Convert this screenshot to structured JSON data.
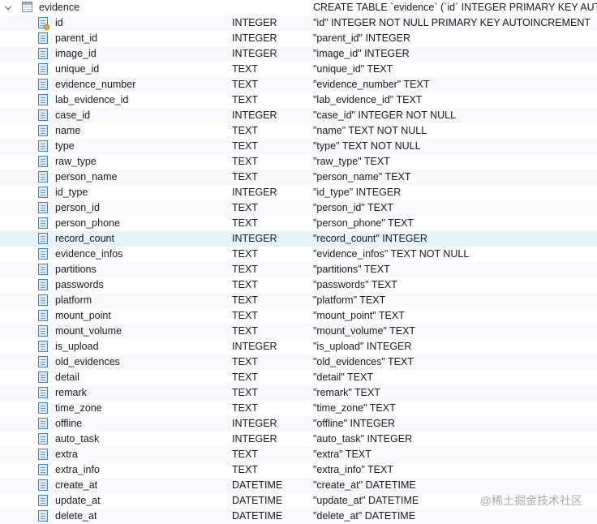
{
  "table": {
    "name": "evidence",
    "schema": "CREATE TABLE `evidence` (`id` INTEGER PRIMARY KEY AUTOINCREMENT"
  },
  "hover_field": "record_count",
  "fields": [
    {
      "name": "id",
      "type": "INTEGER",
      "schema": "\"id\" INTEGER NOT NULL PRIMARY KEY AUTOINCREMENT",
      "key": true
    },
    {
      "name": "parent_id",
      "type": "INTEGER",
      "schema": "\"parent_id\" INTEGER"
    },
    {
      "name": "image_id",
      "type": "INTEGER",
      "schema": "\"image_id\" INTEGER"
    },
    {
      "name": "unique_id",
      "type": "TEXT",
      "schema": "\"unique_id\" TEXT"
    },
    {
      "name": "evidence_number",
      "type": "TEXT",
      "schema": "\"evidence_number\" TEXT"
    },
    {
      "name": "lab_evidence_id",
      "type": "TEXT",
      "schema": "\"lab_evidence_id\" TEXT"
    },
    {
      "name": "case_id",
      "type": "INTEGER",
      "schema": "\"case_id\" INTEGER NOT NULL"
    },
    {
      "name": "name",
      "type": "TEXT",
      "schema": "\"name\" TEXT NOT NULL"
    },
    {
      "name": "type",
      "type": "TEXT",
      "schema": "\"type\" TEXT NOT NULL"
    },
    {
      "name": "raw_type",
      "type": "TEXT",
      "schema": "\"raw_type\" TEXT"
    },
    {
      "name": "person_name",
      "type": "TEXT",
      "schema": "\"person_name\" TEXT"
    },
    {
      "name": "id_type",
      "type": "INTEGER",
      "schema": "\"id_type\" INTEGER"
    },
    {
      "name": "person_id",
      "type": "TEXT",
      "schema": "\"person_id\" TEXT"
    },
    {
      "name": "person_phone",
      "type": "TEXT",
      "schema": "\"person_phone\" TEXT"
    },
    {
      "name": "record_count",
      "type": "INTEGER",
      "schema": "\"record_count\" INTEGER"
    },
    {
      "name": "evidence_infos",
      "type": "TEXT",
      "schema": "\"evidence_infos\" TEXT NOT NULL"
    },
    {
      "name": "partitions",
      "type": "TEXT",
      "schema": "\"partitions\" TEXT"
    },
    {
      "name": "passwords",
      "type": "TEXT",
      "schema": "\"passwords\" TEXT"
    },
    {
      "name": "platform",
      "type": "TEXT",
      "schema": "\"platform\" TEXT"
    },
    {
      "name": "mount_point",
      "type": "TEXT",
      "schema": "\"mount_point\" TEXT"
    },
    {
      "name": "mount_volume",
      "type": "TEXT",
      "schema": "\"mount_volume\" TEXT"
    },
    {
      "name": "is_upload",
      "type": "INTEGER",
      "schema": "\"is_upload\" INTEGER"
    },
    {
      "name": "old_evidences",
      "type": "TEXT",
      "schema": "\"old_evidences\" TEXT"
    },
    {
      "name": "detail",
      "type": "TEXT",
      "schema": "\"detail\" TEXT"
    },
    {
      "name": "remark",
      "type": "TEXT",
      "schema": "\"remark\" TEXT"
    },
    {
      "name": "time_zone",
      "type": "TEXT",
      "schema": "\"time_zone\" TEXT"
    },
    {
      "name": "offline",
      "type": "INTEGER",
      "schema": "\"offline\" INTEGER"
    },
    {
      "name": "auto_task",
      "type": "INTEGER",
      "schema": "\"auto_task\" INTEGER"
    },
    {
      "name": "extra",
      "type": "TEXT",
      "schema": "\"extra\" TEXT"
    },
    {
      "name": "extra_info",
      "type": "TEXT",
      "schema": "\"extra_info\" TEXT"
    },
    {
      "name": "create_at",
      "type": "DATETIME",
      "schema": "\"create_at\" DATETIME"
    },
    {
      "name": "update_at",
      "type": "DATETIME",
      "schema": "\"update_at\" DATETIME"
    },
    {
      "name": "delete_at",
      "type": "DATETIME",
      "schema": "\"delete_at\" DATETIME"
    }
  ],
  "watermark": "@稀土掘金技术社区"
}
